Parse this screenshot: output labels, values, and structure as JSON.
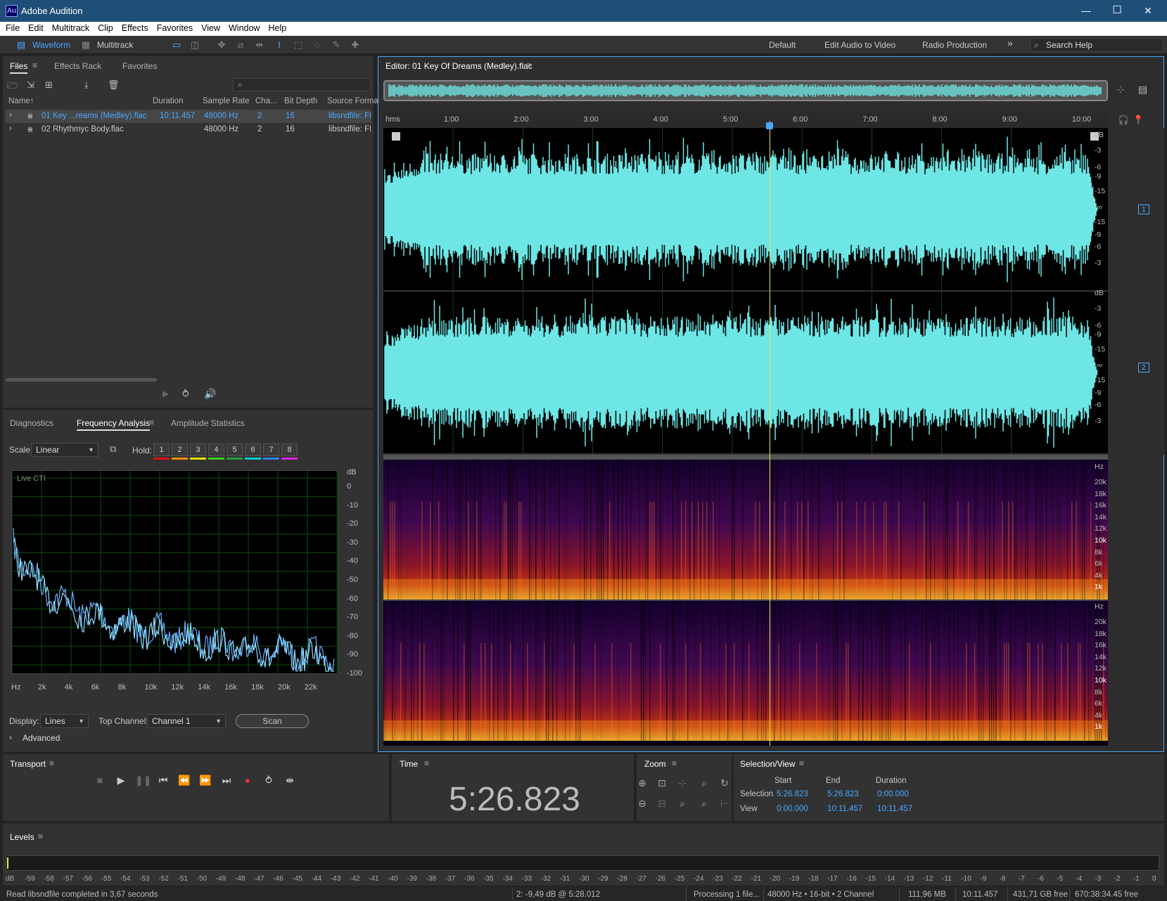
{
  "window": {
    "title": "Adobe Audition",
    "logo": "Au",
    "minimize": "—",
    "maximize": "☐",
    "close": "✕"
  },
  "menu": [
    "File",
    "Edit",
    "Multitrack",
    "Clip",
    "Effects",
    "Favorites",
    "View",
    "Window",
    "Help"
  ],
  "toolbar": {
    "waveform": "Waveform",
    "multitrack": "Multitrack",
    "workspaces": [
      "Default",
      "Edit Audio to Video",
      "Radio Production"
    ],
    "more": "»",
    "search_placeholder": "Search Help"
  },
  "files_panel": {
    "tabs": [
      "Files",
      "Effects Rack",
      "Favorites"
    ],
    "columns": [
      "Name",
      "Duration",
      "Sample Rate",
      "Cha...",
      "Bit Depth",
      "Source Forma"
    ],
    "sort_arrow": "↑",
    "rows": [
      {
        "name": "01 Key ...reams (Medley).flac",
        "duration": "10:11.457",
        "rate": "48000 Hz",
        "ch": "2",
        "bits": "16",
        "format": "libsndfile: FL",
        "selected": true
      },
      {
        "name": "02 Rhythmyc Body.flac",
        "duration": "",
        "rate": "48000 Hz",
        "ch": "2",
        "bits": "16",
        "format": "libsndfile: FL",
        "selected": false
      }
    ]
  },
  "analysis_panel": {
    "tabs": [
      "Diagnostics",
      "Frequency Analysis",
      "Amplitude Statistics"
    ],
    "scale_label": "Scale:",
    "scale_value": "Linear",
    "hold_label": "Hold:",
    "holds": [
      "1",
      "2",
      "3",
      "4",
      "5",
      "6",
      "7",
      "8"
    ],
    "hold_colors": [
      "#e01010",
      "#ff8c00",
      "#e8e000",
      "#40d020",
      "#20a040",
      "#00c8e0",
      "#3080ff",
      "#e020e0"
    ],
    "graph_label": "Live CTI",
    "y_unit": "dB",
    "y_ticks": [
      "0",
      "-10",
      "-20",
      "-30",
      "-40",
      "-50",
      "-60",
      "-70",
      "-80",
      "-90",
      "-100"
    ],
    "x_ticks": [
      "Hz",
      "2k",
      "4k",
      "6k",
      "8k",
      "10k",
      "12k",
      "14k",
      "16k",
      "18k",
      "20k",
      "22k"
    ],
    "display_label": "Display:",
    "display_value": "Lines",
    "top_channel_label": "Top Channel:",
    "top_channel_value": "Channel 1",
    "scan": "Scan",
    "advanced": "Advanced"
  },
  "editor": {
    "title": "Editor: 01 Key Of Dreams (Medley).flac",
    "timeline_unit": "hms",
    "timeline": [
      "1:00",
      "2:00",
      "3:00",
      "4:00",
      "5:00",
      "6:00",
      "7:00",
      "8:00",
      "9:00",
      "10:00"
    ],
    "db_unit": "dB",
    "db_ticks": [
      "-3",
      "-6",
      "-9",
      "-15",
      "-∞",
      "-15",
      "-9",
      "-6",
      "-3"
    ],
    "channel_labels": [
      "1",
      "2"
    ],
    "hz_unit": "Hz",
    "hz_ticks": [
      "20k",
      "18k",
      "16k",
      "14k",
      "12k",
      "10k",
      "8k",
      "6k",
      "4k",
      "1k"
    ],
    "playhead_fraction": 0.533
  },
  "transport": {
    "title": "Transport"
  },
  "time": {
    "title": "Time",
    "value": "5:26.823"
  },
  "zoom": {
    "title": "Zoom"
  },
  "selection_view": {
    "title": "Selection/View",
    "headers": [
      "Start",
      "End",
      "Duration"
    ],
    "rows": [
      {
        "label": "Selection",
        "start": "5:26.823",
        "end": "5:26.823",
        "duration": "0:00.000"
      },
      {
        "label": "View",
        "start": "0:00.000",
        "end": "10:11.457",
        "duration": "10:11.457"
      }
    ]
  },
  "levels": {
    "title": "Levels",
    "ticks": [
      "dB",
      "-59",
      "-58",
      "-57",
      "-56",
      "-55",
      "-54",
      "-53",
      "-52",
      "-51",
      "-50",
      "-49",
      "-48",
      "-47",
      "-46",
      "-45",
      "-44",
      "-43",
      "-42",
      "-41",
      "-40",
      "-39",
      "-38",
      "-37",
      "-36",
      "-35",
      "-34",
      "-33",
      "-32",
      "-31",
      "-30",
      "-29",
      "-28",
      "-27",
      "-26",
      "-25",
      "-24",
      "-23",
      "-22",
      "-21",
      "-20",
      "-19",
      "-18",
      "-17",
      "-16",
      "-15",
      "-14",
      "-13",
      "-12",
      "-11",
      "-10",
      "-9",
      "-8",
      "-7",
      "-6",
      "-5",
      "-4",
      "-3",
      "-2",
      "-1",
      "0"
    ]
  },
  "status": {
    "message": "Read libsndfile completed in 3,67 seconds",
    "cursor": "2: -9,49 dB @ 5:28.012",
    "processing": "Processing 1 file...",
    "format": "48000 Hz • 16-bit • 2 Channel",
    "size": "111,96 MB",
    "duration": "10:11.457",
    "free": "431,71 GB free",
    "free_time": "670:38:34.45 free"
  },
  "colors": {
    "accent": "#4aa8ff",
    "waveform": "#6ee6e6",
    "playhead": "#e8e84a",
    "record": "#e03030"
  },
  "icons": [
    "folder-open-icon",
    "import-icon",
    "new-file-icon",
    "insert-icon",
    "delete-icon",
    "play-icon",
    "loop-icon",
    "speaker-icon",
    "stop-icon",
    "pause-icon",
    "skip-back-icon",
    "rewind-icon",
    "fast-forward-icon",
    "skip-forward-icon",
    "record-icon",
    "skip-selection-icon",
    "search-icon",
    "zoom-in-icon",
    "zoom-out-icon",
    "headphones-icon",
    "pin-icon"
  ]
}
